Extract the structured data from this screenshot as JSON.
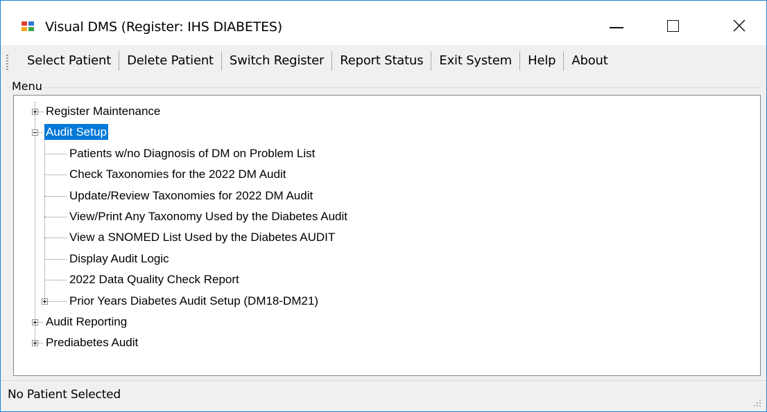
{
  "window": {
    "title": "Visual DMS (Register: IHS DIABETES)"
  },
  "menubar": {
    "items": [
      "Select Patient",
      "Delete Patient",
      "Switch Register",
      "Report Status",
      "Exit System",
      "Help",
      "About"
    ]
  },
  "menu_group": {
    "label": "Menu"
  },
  "tree": {
    "nodes": [
      {
        "label": "Register Maintenance",
        "level": 0,
        "expander": "plus"
      },
      {
        "label": "Audit Setup",
        "level": 0,
        "expander": "minus",
        "selected": true
      },
      {
        "label": "Patients w/no Diagnosis of DM on Problem List",
        "level": 1
      },
      {
        "label": "Check Taxonomies for the 2022 DM Audit",
        "level": 1
      },
      {
        "label": "Update/Review Taxonomies for 2022 DM Audit",
        "level": 1
      },
      {
        "label": "View/Print Any Taxonomy Used by the Diabetes Audit",
        "level": 1
      },
      {
        "label": "View a SNOMED List Used by the Diabetes AUDIT",
        "level": 1
      },
      {
        "label": "Display Audit Logic",
        "level": 1
      },
      {
        "label": "2022 Data Quality Check Report",
        "level": 1
      },
      {
        "label": "Prior Years Diabetes Audit Setup (DM18-DM21)",
        "level": 1,
        "expander": "plus"
      },
      {
        "label": "Audit Reporting",
        "level": 0,
        "expander": "plus"
      },
      {
        "label": "Prediabetes Audit",
        "level": 0,
        "expander": "plus"
      }
    ]
  },
  "statusbar": {
    "text": "No Patient Selected"
  },
  "colors": {
    "selection": "#0078d7",
    "window_border": "#1883d7",
    "chrome": "#f0f0f0"
  }
}
